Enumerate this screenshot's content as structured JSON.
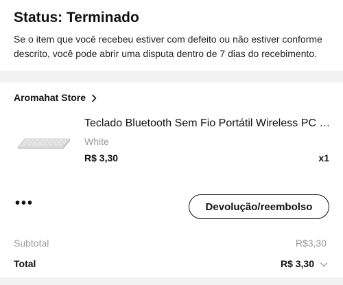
{
  "status": {
    "title": "Status: Terminado",
    "description": "Se o item que você recebeu estiver com defeito ou não estiver conforme descrito, você pode abrir uma disputa dentro de 7 dias do recebimento."
  },
  "order": {
    "store_name": "Aromahat Store",
    "store_icon": "chevron-right-icon",
    "product": {
      "image": "keyboard-product-image",
      "title": "Teclado Bluetooth Sem Fio Portátil Wireless PC …",
      "variant": "White",
      "price": "R$ 3,30",
      "quantity": "x1"
    },
    "more_label": "•••",
    "refund_button": "Devolução/reembolso",
    "subtotal_label": "Subtotal",
    "subtotal_value": "R$3,30",
    "total_label": "Total",
    "total_value": "R$ 3,30",
    "total_icon": "chevron-down-icon"
  },
  "colors": {
    "background": "#f2f2f2",
    "card": "#ffffff",
    "text": "#111111",
    "muted": "#999999"
  }
}
